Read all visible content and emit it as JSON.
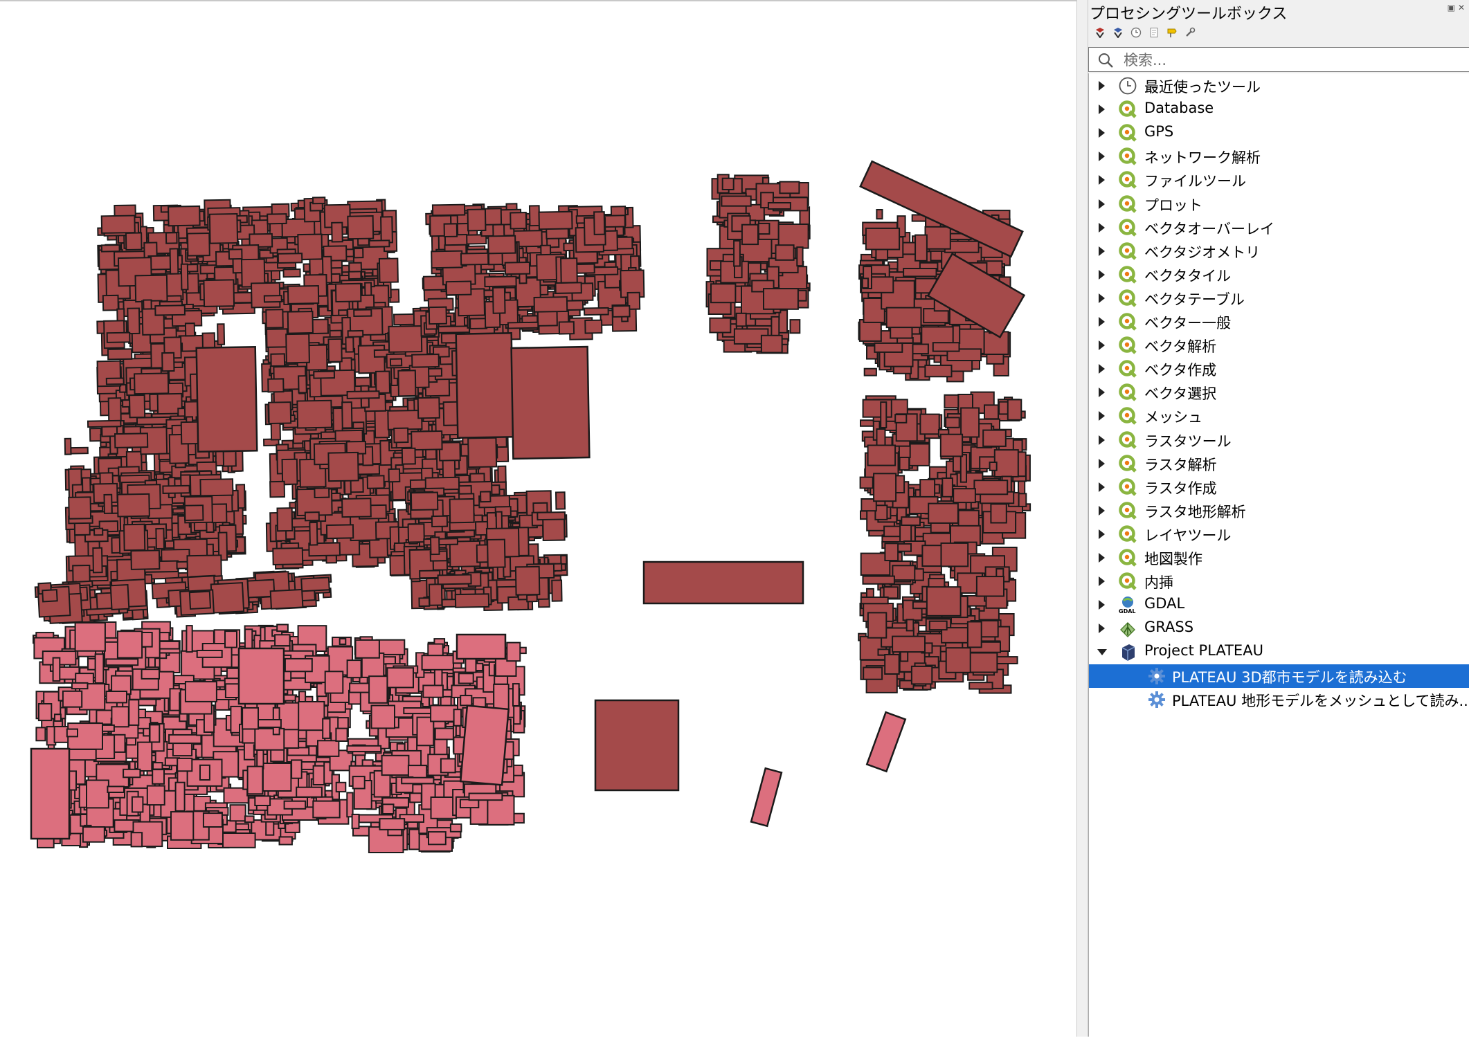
{
  "panel": {
    "title": "プロセシングツールボックス",
    "search_placeholder": "検索..."
  },
  "toolbar": [
    "run-model-icon",
    "edit-model-icon",
    "history-icon",
    "results-icon",
    "edit-features-icon",
    "options-icon"
  ],
  "tree": {
    "items": [
      {
        "label": "最近使ったツール",
        "icon": "clock-icon"
      },
      {
        "label": "Database",
        "icon": "qgis-icon"
      },
      {
        "label": "GPS",
        "icon": "qgis-icon"
      },
      {
        "label": "ネットワーク解析",
        "icon": "qgis-icon"
      },
      {
        "label": "ファイルツール",
        "icon": "qgis-icon"
      },
      {
        "label": "プロット",
        "icon": "qgis-icon"
      },
      {
        "label": "ベクタオーバーレイ",
        "icon": "qgis-icon"
      },
      {
        "label": "ベクタジオメトリ",
        "icon": "qgis-icon"
      },
      {
        "label": "ベクタタイル",
        "icon": "qgis-icon"
      },
      {
        "label": "ベクタテーブル",
        "icon": "qgis-icon"
      },
      {
        "label": "ベクター一般",
        "icon": "qgis-icon"
      },
      {
        "label": "ベクタ解析",
        "icon": "qgis-icon"
      },
      {
        "label": "ベクタ作成",
        "icon": "qgis-icon"
      },
      {
        "label": "ベクタ選択",
        "icon": "qgis-icon"
      },
      {
        "label": "メッシュ",
        "icon": "qgis-icon"
      },
      {
        "label": "ラスタツール",
        "icon": "qgis-icon"
      },
      {
        "label": "ラスタ解析",
        "icon": "qgis-icon"
      },
      {
        "label": "ラスタ作成",
        "icon": "qgis-icon"
      },
      {
        "label": "ラスタ地形解析",
        "icon": "qgis-icon"
      },
      {
        "label": "レイヤツール",
        "icon": "qgis-icon"
      },
      {
        "label": "地図製作",
        "icon": "qgis-icon"
      },
      {
        "label": "内挿",
        "icon": "qgis-icon"
      },
      {
        "label": "GDAL",
        "icon": "gdal-icon"
      },
      {
        "label": "GRASS",
        "icon": "grass-icon"
      },
      {
        "label": "Project PLATEAU",
        "icon": "plateau-icon",
        "expanded": true
      }
    ],
    "children": [
      {
        "label": "PLATEAU 3D都市モデルを読み込む",
        "icon": "gear-icon",
        "selected": true
      },
      {
        "label": "PLATEAU 地形モデルをメッシュとして読み...",
        "icon": "gear-icon"
      }
    ]
  },
  "colors": {
    "building_dark": "#a44a4a",
    "building_light": "#dc6f7e",
    "selection": "#1c6fd4",
    "qgis_green": "#8ab540"
  }
}
